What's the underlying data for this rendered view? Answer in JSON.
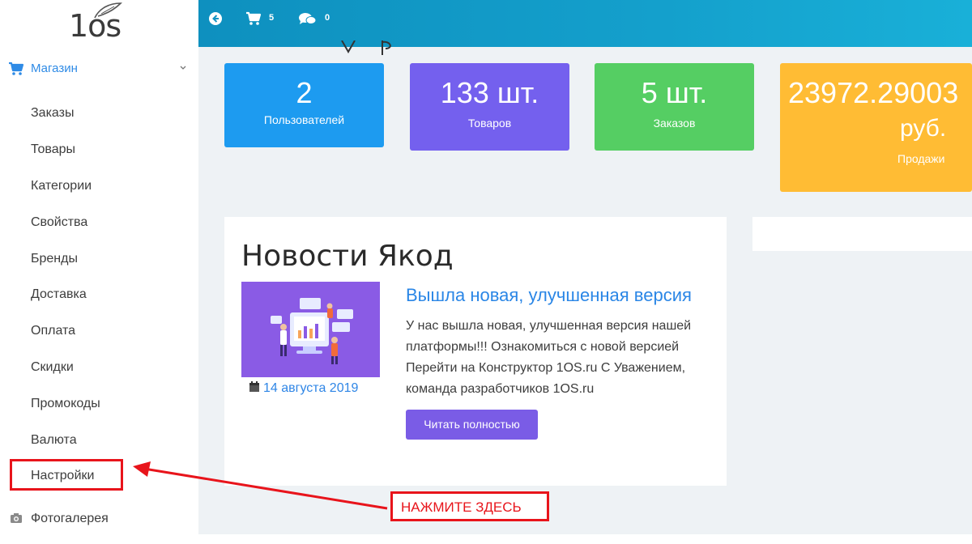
{
  "logo": {
    "text": "1os"
  },
  "sidebar": {
    "section": {
      "label": "Магазин",
      "icon": "cart-icon"
    },
    "items": [
      {
        "label": "Заказы"
      },
      {
        "label": "Товары"
      },
      {
        "label": "Категории"
      },
      {
        "label": "Свойства"
      },
      {
        "label": "Бренды"
      },
      {
        "label": "Доставка"
      },
      {
        "label": "Оплата"
      },
      {
        "label": "Скидки"
      },
      {
        "label": "Промокоды"
      },
      {
        "label": "Валюта"
      },
      {
        "label": "Настройки"
      }
    ],
    "gallery": {
      "label": "Фотогалерея",
      "icon": "camera-icon"
    }
  },
  "topbar": {
    "icons": [
      "back-circle-icon",
      "cart-icon",
      "comments-icon"
    ],
    "cart_count": "5",
    "messages_count": "0"
  },
  "stats": [
    {
      "value": "2",
      "label": "Пользователей",
      "color": "#1d9bf0"
    },
    {
      "value": "133 шт.",
      "label": "Товаров",
      "color": "#7460ee"
    },
    {
      "value": "5 шт.",
      "label": "Заказов",
      "color": "#55ce63"
    },
    {
      "value": "23972.29003",
      "unit": "руб.",
      "label": "Продажи",
      "color": "#ffbc34"
    }
  ],
  "news": {
    "title": "Новости Якод",
    "headline": "Вышла новая, улучшенная версия",
    "body": "У нас вышла новая, улучшенная версия нашей платформы!!! Ознакомиться с новой версией Перейти на Конструктор 1OS.ru С Уважением, команда разработчиков 1OS.ru",
    "date": "14 августа 2019",
    "button_label": "Читать полностью"
  },
  "annotation": {
    "label": "НАЖМИТЕ ЗДЕСЬ",
    "color": "#e8141b"
  }
}
